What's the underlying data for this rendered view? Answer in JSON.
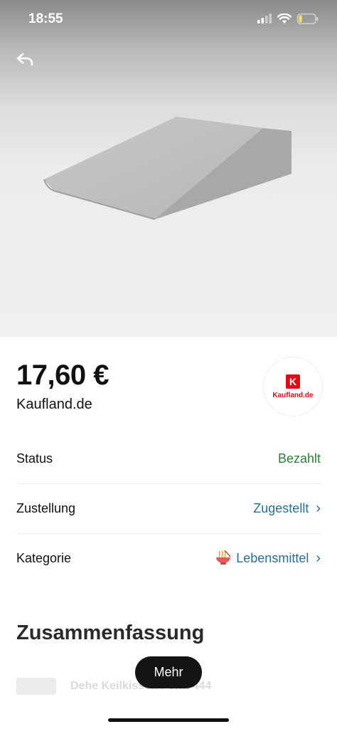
{
  "status_bar": {
    "time": "18:55",
    "battery_color": "#f2e36b"
  },
  "nav": {
    "back_icon": "reply-arrow-icon"
  },
  "product": {
    "image_alt": "grey wedge pillow"
  },
  "purchase": {
    "price": "17,60 €",
    "merchant": "Kaufland.de",
    "merchant_logo_text": "Kaufland.de",
    "merchant_logo_mark": "K",
    "brand_color": "#e10915"
  },
  "details": {
    "status": {
      "label": "Status",
      "value": "Bezahlt",
      "color": "#2e7d3d"
    },
    "delivery": {
      "label": "Zustellung",
      "value": "Zugestellt",
      "color": "#2c6e8c"
    },
    "category": {
      "label": "Kategorie",
      "value": "Lebensmittel",
      "icon": "noodle-bowl-icon",
      "color": "#2c6e8c"
    }
  },
  "summary": {
    "title": "Zusammenfassung",
    "faded_item": "Dehe Keilkissen Form 444"
  },
  "actions": {
    "more_label": "Mehr"
  }
}
